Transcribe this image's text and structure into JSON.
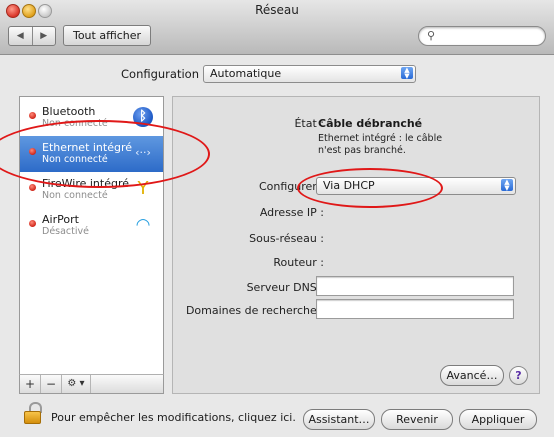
{
  "window": {
    "title": "Réseau"
  },
  "toolbar": {
    "back": "◀",
    "forward": "▶",
    "show_all": "Tout afficher",
    "search_placeholder": ""
  },
  "configuration": {
    "label": "Configuration :",
    "value": "Automatique"
  },
  "services": [
    {
      "name": "Bluetooth",
      "status": "Non connecté",
      "icon": "bluetooth-icon",
      "selected": false
    },
    {
      "name": "Ethernet intégré",
      "status": "Non connecté",
      "icon": "ethernet-icon",
      "selected": true
    },
    {
      "name": "FireWire intégré",
      "status": "Non connecté",
      "icon": "firewire-icon",
      "selected": false
    },
    {
      "name": "AirPort",
      "status": "Désactivé",
      "icon": "airport-wifi-icon",
      "selected": false
    }
  ],
  "sidebar_tools": {
    "add": "+",
    "remove": "−",
    "gear": "⚙ ▾"
  },
  "detail": {
    "state_label": "État :",
    "state_value": "Câble débranché",
    "state_description": "Ethernet intégré : le câble n'est pas branché.",
    "configure_label": "Configurer :",
    "configure_value": "Via DHCP",
    "ip_label": "Adresse IP :",
    "subnet_label": "Sous-réseau :",
    "router_label": "Routeur :",
    "dns_label": "Serveur DNS :",
    "dns_value": "",
    "search_domains_label": "Domaines de recherche :",
    "search_domains_value": "",
    "advanced_button": "Avancé…",
    "help_button": "?"
  },
  "footer": {
    "lock_text": "Pour empêcher les modifications, cliquez ici.",
    "assistant_button": "Assistant…",
    "revert_button": "Revenir",
    "apply_button": "Appliquer"
  },
  "colors": {
    "selection": "#2d6bc8",
    "status_dot": "#cc1e12",
    "annotation": "#e01818"
  }
}
